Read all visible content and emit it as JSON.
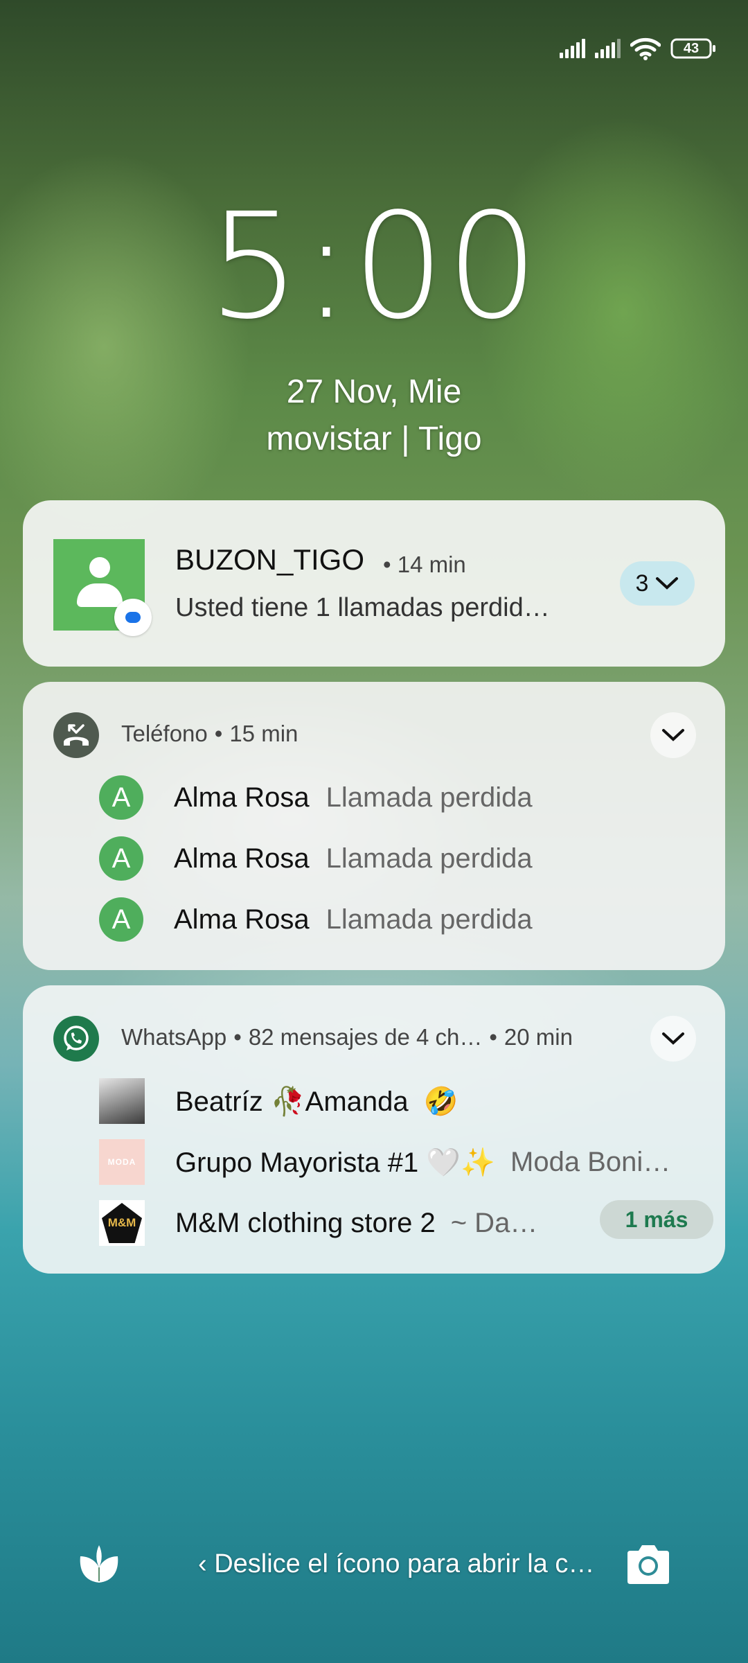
{
  "status_bar": {
    "battery": "43",
    "icons": [
      "signal-icon",
      "signal-icon",
      "wifi-icon",
      "battery-icon"
    ]
  },
  "lockscreen": {
    "time": "5:00",
    "date": "27 Nov, Mie",
    "carrier": "movistar | Tigo"
  },
  "notifications": {
    "buzon": {
      "title": "BUZON_TIGO",
      "time": "• 14 min",
      "body": "Usted tiene 1 llamadas perdid…",
      "count": "3"
    },
    "telefono": {
      "app": "Teléfono",
      "time": "15 min",
      "rows": [
        {
          "initial": "A",
          "name": "Alma Rosa",
          "status": "Llamada perdida"
        },
        {
          "initial": "A",
          "name": "Alma Rosa",
          "status": "Llamada perdida"
        },
        {
          "initial": "A",
          "name": "Alma Rosa",
          "status": "Llamada perdida"
        }
      ]
    },
    "whatsapp": {
      "app": "WhatsApp",
      "summary": "82 mensajes de 4 ch…",
      "time": "20 min",
      "rows": [
        {
          "name": "Beatríz 🥀Amanda",
          "message": "🤣"
        },
        {
          "name": "Grupo Mayorista #1 🤍✨",
          "message": "Moda Boni…",
          "thumb_text": "MODA"
        },
        {
          "name": "M&M clothing store 2",
          "message": "~ Da…",
          "thumb_text": "M&M"
        }
      ],
      "more": "1 más"
    }
  },
  "bottom": {
    "hint": "‹ Deslice el ícono para abrir la c…"
  },
  "colors": {
    "contact_green": "#5cb85c",
    "whatsapp_green": "#1f7a4c",
    "pill_blue": "#c8e8ee"
  }
}
